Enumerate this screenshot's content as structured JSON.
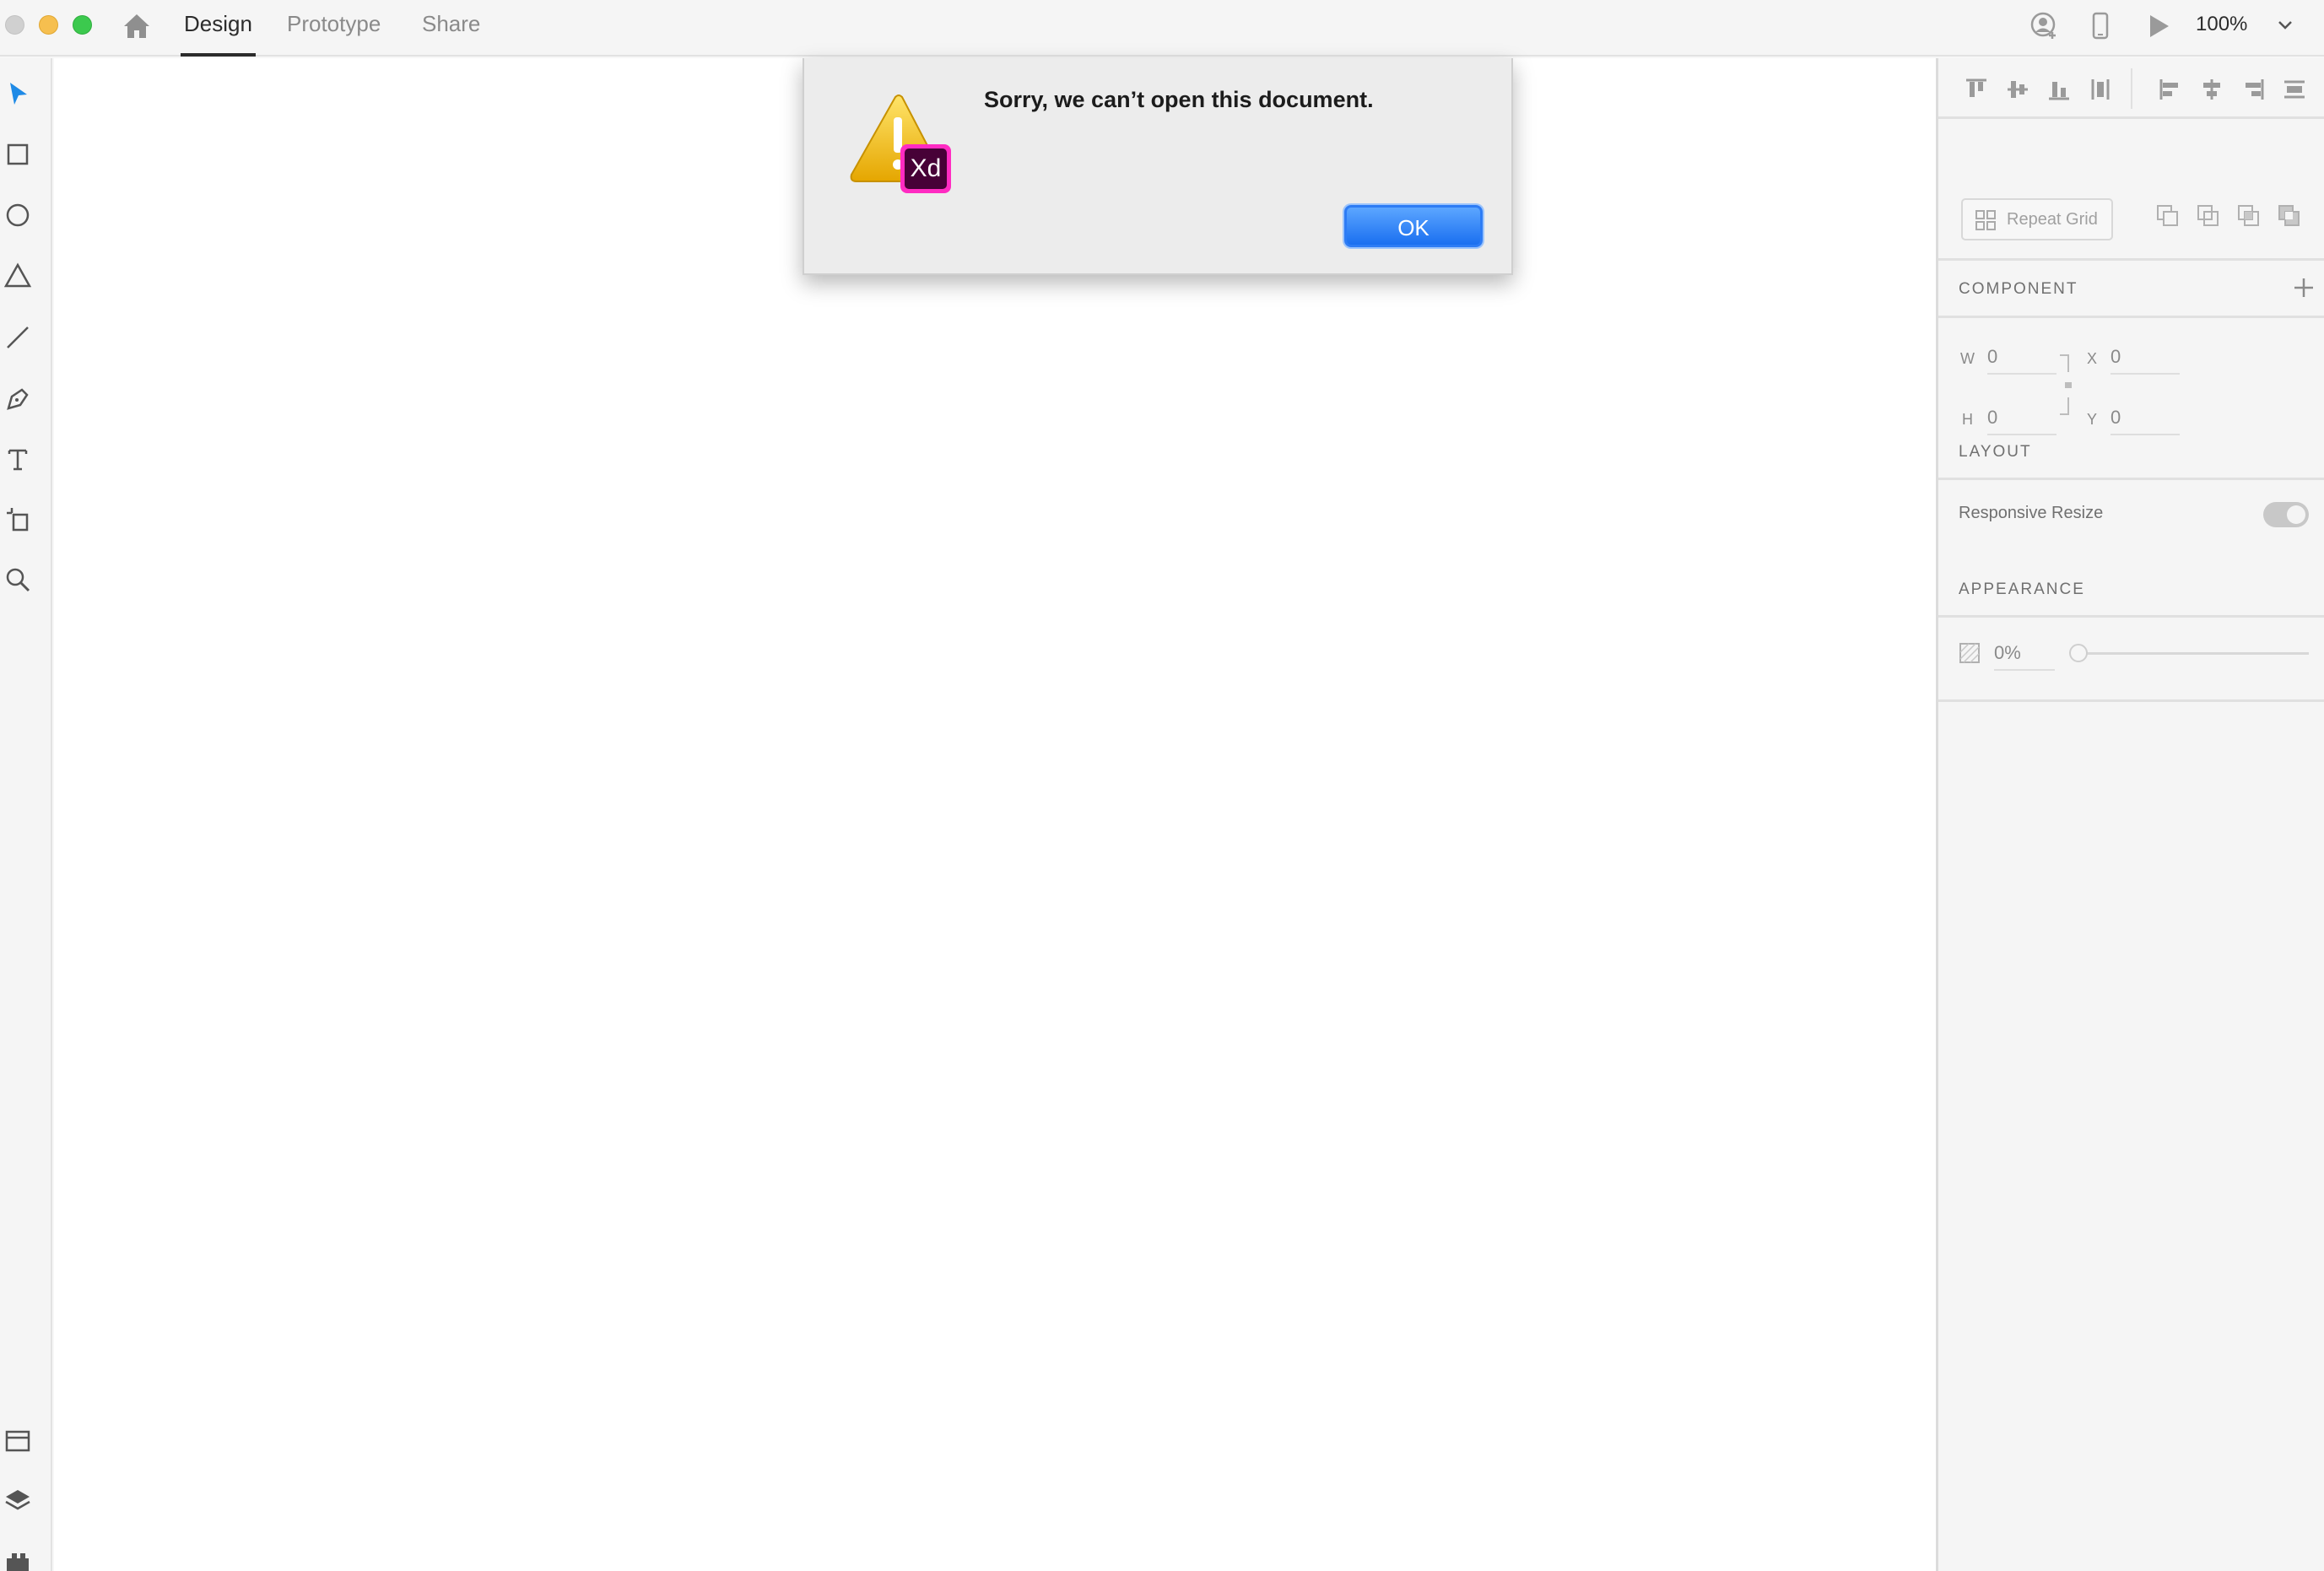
{
  "titlebar": {
    "tabs": [
      {
        "label": "Design",
        "active": true
      },
      {
        "label": "Prototype",
        "active": false
      },
      {
        "label": "Share",
        "active": false
      }
    ],
    "zoom": "100%",
    "icons": [
      "home-icon",
      "share-user-icon",
      "device-preview-icon",
      "play-icon",
      "chevron-down-icon"
    ]
  },
  "toolbar": {
    "tools": [
      "select-tool-icon",
      "rectangle-tool-icon",
      "ellipse-tool-icon",
      "polygon-tool-icon",
      "line-tool-icon",
      "pen-tool-icon",
      "text-tool-icon",
      "artboard-tool-icon",
      "zoom-tool-icon"
    ],
    "bottom": [
      "assets-icon",
      "layers-icon",
      "plugins-icon"
    ]
  },
  "panel": {
    "repeat_grid_label": "Repeat Grid",
    "component_label": "COMPONENT",
    "w_label": "W",
    "w_value": "0",
    "h_label": "H",
    "h_value": "0",
    "x_label": "X",
    "x_value": "0",
    "y_label": "Y",
    "y_value": "0",
    "layout_label": "LAYOUT",
    "responsive_label": "Responsive Resize",
    "responsive_on": true,
    "appearance_label": "APPEARANCE",
    "opacity_value": "0%"
  },
  "dialog": {
    "message": "Sorry, we can’t open this document.",
    "ok_label": "OK",
    "badge_text": "Xd",
    "colors": {
      "button": "#1a6ff0",
      "badge": "#ff2bc2",
      "warning": "#f3c020"
    }
  }
}
